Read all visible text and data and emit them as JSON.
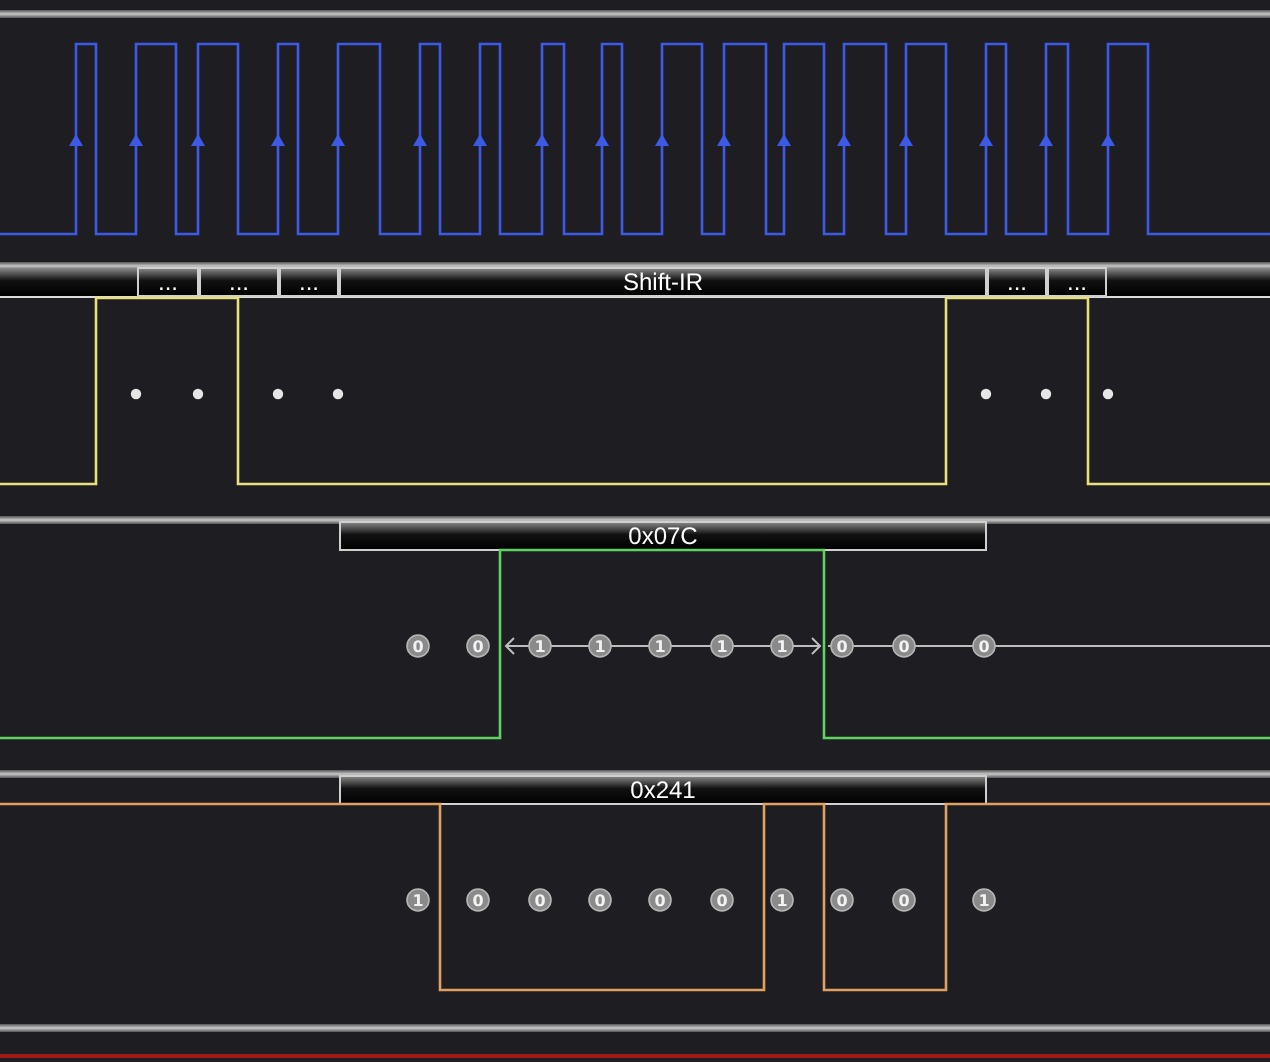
{
  "channels": [
    {
      "kind": "clock",
      "color": "#3d5ae6"
    },
    {
      "kind": "markers",
      "color": "#e8e07a",
      "annotations": [
        "...",
        "...",
        "...",
        "Shift-IR",
        "...",
        "..."
      ]
    },
    {
      "kind": "bits",
      "color": "#5fd35f",
      "annotations": [
        "0x07C"
      ],
      "bits": [
        "0",
        "0",
        "1",
        "1",
        "1",
        "1",
        "1",
        "0",
        "0",
        "0"
      ]
    },
    {
      "kind": "bits",
      "color": "#e0a060",
      "annotations": [
        "0x241"
      ],
      "bits": [
        "1",
        "0",
        "0",
        "0",
        "0",
        "0",
        "1",
        "0",
        "0",
        "1"
      ]
    }
  ]
}
